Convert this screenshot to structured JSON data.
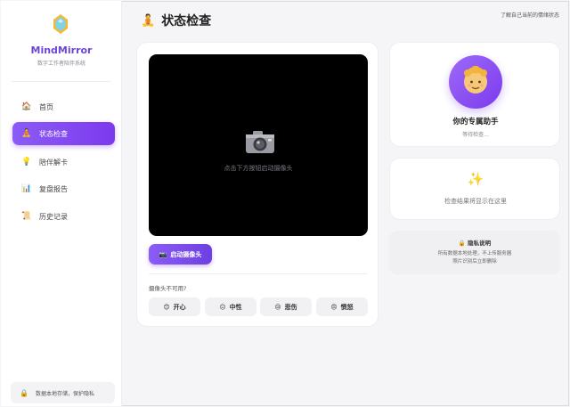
{
  "sidebar": {
    "brand": "MindMirror",
    "subtitle": "数字工作者陪伴系统",
    "nav": [
      {
        "label": "首页",
        "icon": "house-icon",
        "glyph": "🏠"
      },
      {
        "label": "状态检查",
        "icon": "meditation-icon",
        "glyph": "🧘"
      },
      {
        "label": "陪伴解卡",
        "icon": "lightbulb-icon",
        "glyph": "💡"
      },
      {
        "label": "复盘报告",
        "icon": "bar-chart-icon",
        "glyph": "📊"
      },
      {
        "label": "历史记录",
        "icon": "scroll-icon",
        "glyph": "📜"
      }
    ],
    "active_index": 1,
    "footer": {
      "icon": "lock-icon",
      "glyph": "🔒",
      "text": "数据本地存储，保护隐私"
    }
  },
  "header": {
    "icon": "meditation-icon",
    "glyph": "🧘",
    "title": "状态检查",
    "hint": "了解自己当前的情绪状态"
  },
  "camera": {
    "video_hint": "点击下方按钮启动摄像头",
    "start_button": {
      "icon": "camera-icon",
      "glyph": "📷",
      "label": "启动摄像头"
    },
    "fallback_label": "摄像头不可用?",
    "emotions": [
      {
        "label": "开心",
        "icon": "happy-face-icon",
        "glyph": "😊"
      },
      {
        "label": "中性",
        "icon": "neutral-face-icon",
        "glyph": "😐"
      },
      {
        "label": "悲伤",
        "icon": "sad-face-icon",
        "glyph": "😢"
      },
      {
        "label": "愤怒",
        "icon": "angry-face-icon",
        "glyph": "😠"
      }
    ]
  },
  "assistant": {
    "name": "你的专属助手",
    "status": "等待检查..."
  },
  "result": {
    "icon": "sparkle-icon",
    "glyph": "✨",
    "text": "检查结果将显示在这里"
  },
  "privacy": {
    "icon": "lock-icon",
    "glyph": "🔒",
    "title": "隐私说明",
    "lines": [
      "所有数据本地处理，不上传服务器",
      "照片识别后立即删除"
    ]
  },
  "colors": {
    "accent": "#7c3aed",
    "accent_light": "#8b5cf6",
    "video_bg": "#000000"
  }
}
